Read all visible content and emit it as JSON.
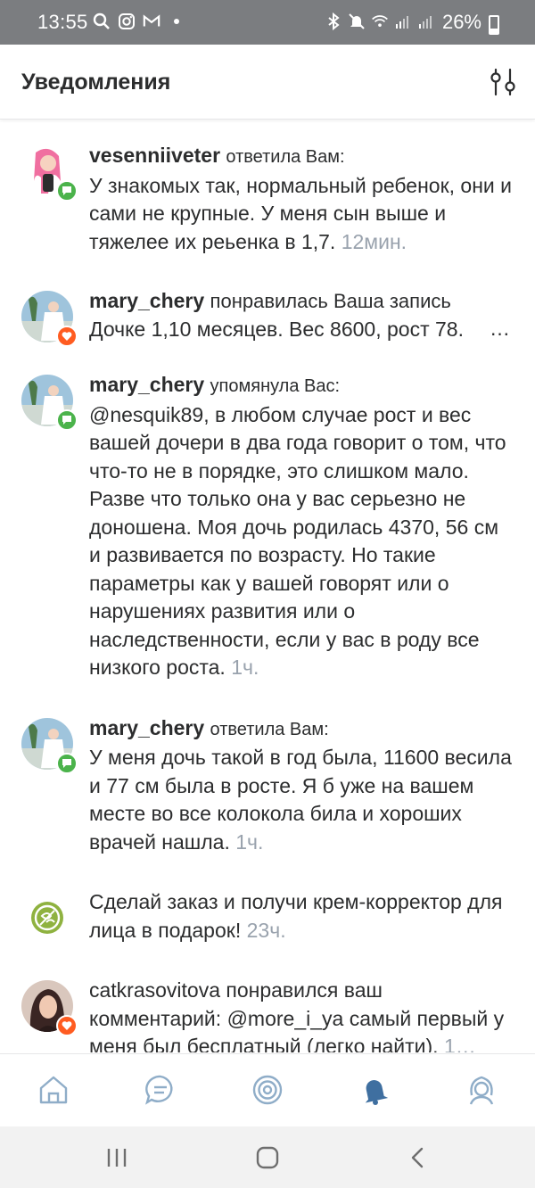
{
  "status_bar": {
    "time": "13:55",
    "battery": "26%"
  },
  "header": {
    "title": "Уведомления",
    "filter_icon": "sliders-icon"
  },
  "notifications": [
    {
      "username": "vesenniiveter",
      "action": "ответила Вам:",
      "body": "У знакомых так, нормальный ребенок, они и сами не крупные. У меня сын выше и тяжелее их реьенка в 1,7.",
      "time": "12мин.",
      "badge": "reply-icon"
    },
    {
      "username": "mary_chery",
      "action": "понравилась Ваша запись",
      "body": "Дочке 1,10 месяцев. Вес 8600, рост 78.",
      "ellipsis": "…",
      "badge": "heart-icon"
    },
    {
      "username": "mary_chery",
      "action": "упомянула Вас:",
      "body": "@nesquik89, в любом случае рост и вес вашей дочери в два года говорит о том, что что-то не в порядке, это слишком мало. Разве что только она у вас серьезно не доношена. Моя дочь родилась 4370, 56 см и развивается по возрасту. Но такие параметры как у вашей говорят или о нарушениях развития или о наследственности, если у вас в роду все низкого роста.",
      "time": "1ч.",
      "badge": "reply-icon"
    },
    {
      "username": "mary_chery",
      "action": "ответила Вам:",
      "body": "У меня дочь такой в год была, 11600 весила и 77 см была в росте. Я б уже на вашем месте во все колокола била и хороших врачей нашла.",
      "time": "1ч.",
      "badge": "reply-icon"
    },
    {
      "body": "Сделай заказ и получи крем-корректор для лица в подарок!",
      "time": "23ч.",
      "badge": ""
    },
    {
      "body": "catkrasovitova понравился ваш комментарий: @more_i_ya самый первый у меня был бесплатный (легко найти).",
      "time": "1…",
      "badge": "heart-icon"
    }
  ],
  "tabs": [
    "home-icon",
    "messages-icon",
    "discover-icon",
    "notifications-icon",
    "profile-icon"
  ],
  "colors": {
    "badge_reply": "#4bb34b",
    "badge_like": "#ff5c21",
    "muted": "#99a2ad",
    "tab_icon": "#8fadc8",
    "active_tab": "#3f6fa0"
  }
}
